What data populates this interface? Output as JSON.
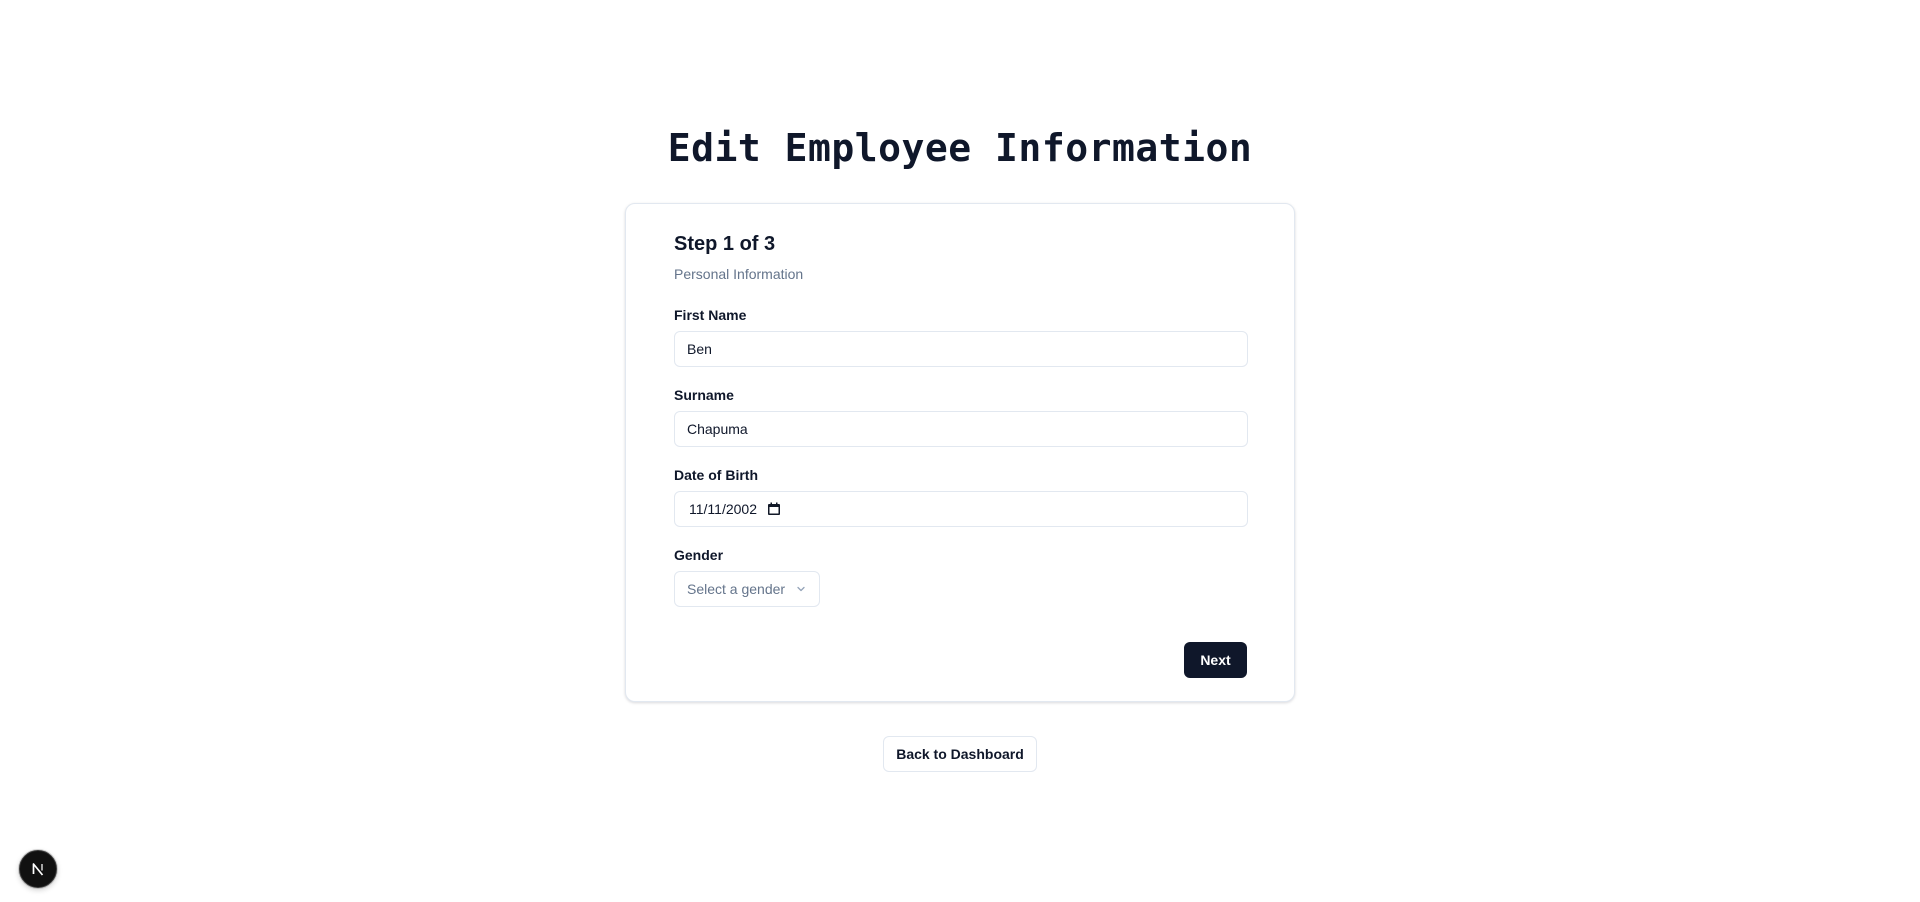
{
  "page": {
    "title": "Edit Employee Information",
    "back_label": "Back to Dashboard"
  },
  "form": {
    "step": "Step 1 of 3",
    "section": "Personal Information",
    "fields": {
      "first_name": {
        "label": "First Name",
        "value": "Ben"
      },
      "surname": {
        "label": "Surname",
        "value": "Chapuma"
      },
      "dob": {
        "label": "Date of Birth",
        "value": "11/11/2002"
      },
      "gender": {
        "label": "Gender",
        "placeholder": "Select a gender"
      }
    },
    "next_label": "Next"
  },
  "badge": {
    "letter": "N",
    "icon": "nextjs-logo-icon"
  },
  "colors": {
    "primary": "#0f172a",
    "muted": "#64748b",
    "border": "#e2e8f0"
  }
}
